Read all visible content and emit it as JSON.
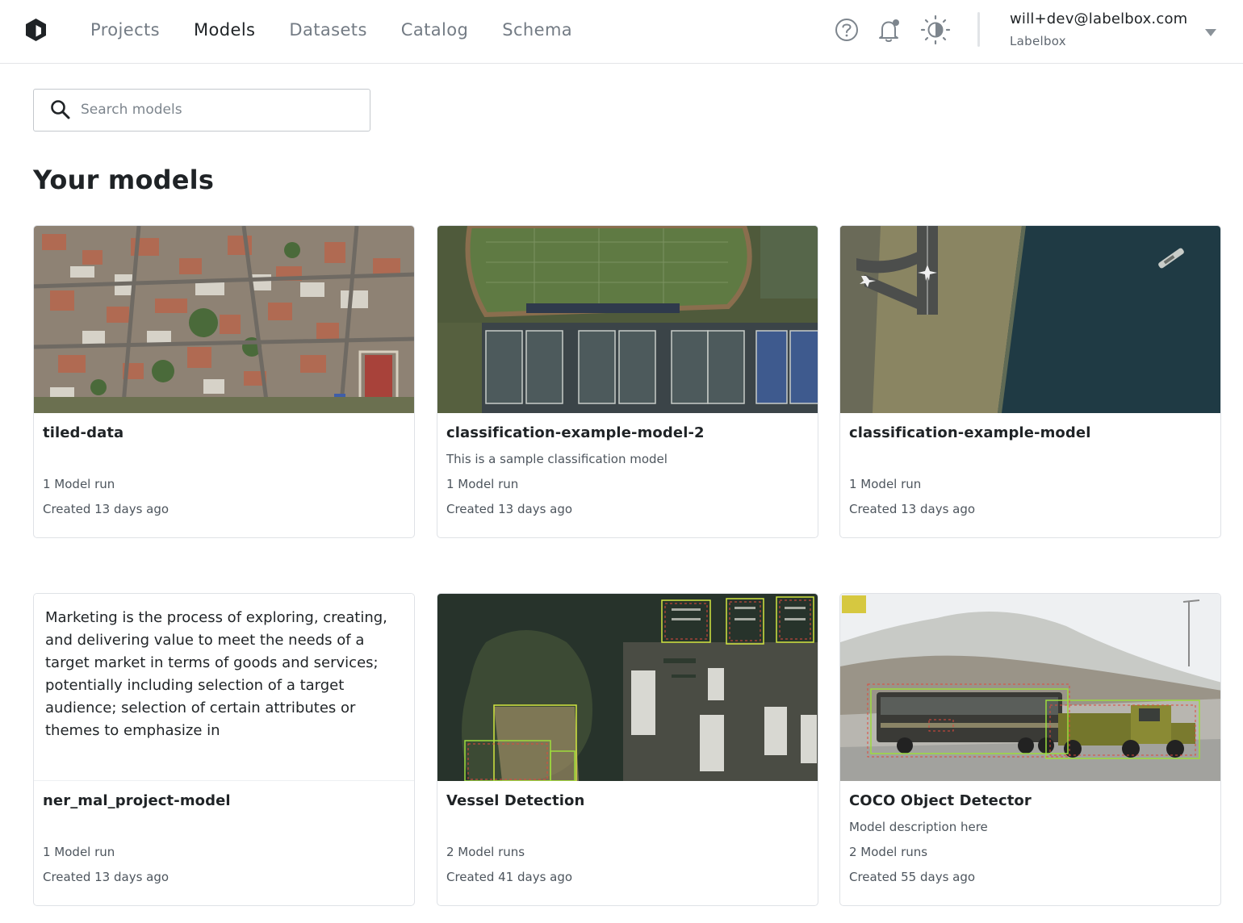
{
  "header": {
    "logo_icon": "labelbox-logo-icon",
    "nav": [
      {
        "label": "Projects",
        "active": false
      },
      {
        "label": "Models",
        "active": true
      },
      {
        "label": "Datasets",
        "active": false
      },
      {
        "label": "Catalog",
        "active": false
      },
      {
        "label": "Schema",
        "active": false
      }
    ],
    "icons": [
      "help-icon",
      "notification-bell-icon",
      "theme-toggle-icon"
    ],
    "user": {
      "email": "will+dev@labelbox.com",
      "org": "Labelbox"
    }
  },
  "search": {
    "placeholder": "Search models",
    "value": ""
  },
  "page": {
    "title": "Your models"
  },
  "models": [
    {
      "name": "tiled-data",
      "description": "",
      "runs": "1 Model run",
      "created": "Created 13 days ago",
      "thumbnail": "aerial-city"
    },
    {
      "name": "classification-example-model-2",
      "description": "This is a sample classification model",
      "runs": "1 Model run",
      "created": "Created 13 days ago",
      "thumbnail": "aerial-tennis-courts"
    },
    {
      "name": "classification-example-model",
      "description": "",
      "runs": "1 Model run",
      "created": "Created 13 days ago",
      "thumbnail": "aerial-airport-water"
    },
    {
      "name": "ner_mal_project-model",
      "description": "",
      "runs": "1 Model run",
      "created": "Created 13 days ago",
      "thumbnail_text": "Marketing is the process of exploring, creating, and delivering value to meet the needs of a target market in terms of goods and services; potentially including selection of a target audience; selection of certain attributes or themes to emphasize in"
    },
    {
      "name": "Vessel Detection",
      "description": "",
      "runs": "2 Model runs",
      "created": "Created 41 days ago",
      "thumbnail": "aerial-marina-boxes"
    },
    {
      "name": "COCO Object Detector",
      "description": "Model description here",
      "runs": "2 Model runs",
      "created": "Created 55 days ago",
      "thumbnail": "bus-truck-snow-boxes"
    }
  ],
  "colors": {
    "text_primary": "#1f2326",
    "text_secondary": "#737b84",
    "border": "#dfe2e6",
    "box_green": "#9ddc3c",
    "box_red": "#e0483c"
  }
}
